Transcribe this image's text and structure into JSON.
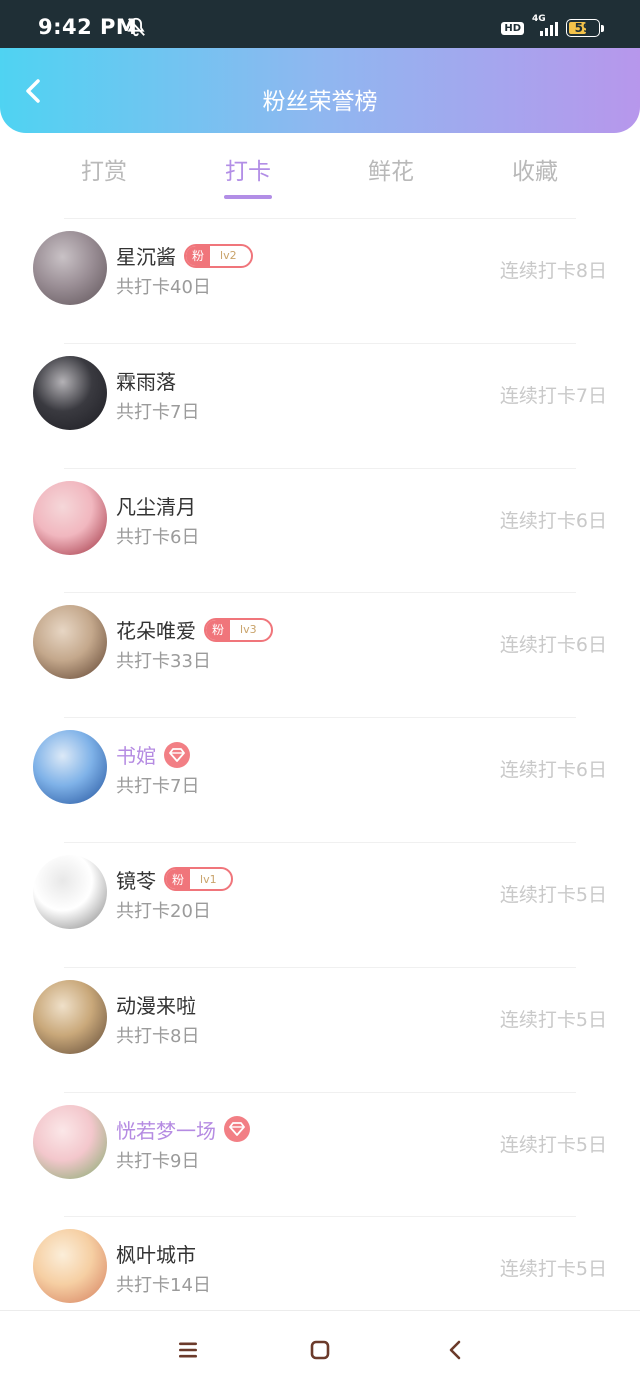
{
  "status": {
    "time": "9:42 PM",
    "hd": "HD",
    "network": "4G",
    "battery": "59"
  },
  "header": {
    "title": "粉丝荣誉榜"
  },
  "tabs": [
    {
      "label": "打赏",
      "active": false
    },
    {
      "label": "打卡",
      "active": true
    },
    {
      "label": "鲜花",
      "active": false
    },
    {
      "label": "收藏",
      "active": false
    }
  ],
  "fans": [
    {
      "name": "星沉酱",
      "badge_prefix": "粉",
      "badge_level": "lv2",
      "total": "共打卡40日",
      "streak": "连续打卡8日",
      "avatar_colors": [
        "#9b8f96",
        "#5d5257",
        "#c9c2c6"
      ]
    },
    {
      "name": "霖雨落",
      "total": "共打卡7日",
      "streak": "连续打卡7日",
      "avatar_colors": [
        "#3a3a40",
        "#1c1c22",
        "#b4b2b6"
      ]
    },
    {
      "name": "凡尘清月",
      "total": "共打卡6日",
      "streak": "连续打卡6日",
      "avatar_colors": [
        "#f1b7bf",
        "#9c2b3b",
        "#f5d7d9"
      ]
    },
    {
      "name": "花朵唯爱",
      "badge_prefix": "粉",
      "badge_level": "lv3",
      "total": "共打卡33日",
      "streak": "连续打卡6日",
      "avatar_colors": [
        "#c4a88c",
        "#5a3e2c",
        "#e7d6c4"
      ]
    },
    {
      "name": "书婠",
      "vip": true,
      "total": "共打卡7日",
      "streak": "连续打卡6日",
      "avatar_colors": [
        "#7fb2e8",
        "#1f4f9a",
        "#dce9f7"
      ]
    },
    {
      "name": "镜苓",
      "badge_prefix": "粉",
      "badge_level": "lv1",
      "total": "共打卡20日",
      "streak": "连续打卡5日",
      "avatar_colors": [
        "#ffffff",
        "#7c7c7c",
        "#e8e8e8"
      ]
    },
    {
      "name": "动漫来啦",
      "total": "共打卡8日",
      "streak": "连续打卡5日",
      "avatar_colors": [
        "#c9a87a",
        "#5c4634",
        "#efe0c9"
      ]
    },
    {
      "name": "恍若梦一场",
      "vip": true,
      "total": "共打卡9日",
      "streak": "连续打卡5日",
      "avatar_colors": [
        "#f3c7cc",
        "#7faa6a",
        "#fbe7e8"
      ]
    },
    {
      "name": "枫叶城市",
      "total": "共打卡14日",
      "streak": "连续打卡5日",
      "avatar_colors": [
        "#f6cfa3",
        "#d37b5b",
        "#fbeed9"
      ]
    }
  ],
  "colors": {
    "accent": "#b28ee6",
    "header_start": "#4fd3f2",
    "header_end": "#b797ec",
    "badge": "#f0757b"
  },
  "nav": {
    "icons": [
      "menu-icon",
      "home-square-icon",
      "back-chevron-icon"
    ]
  }
}
